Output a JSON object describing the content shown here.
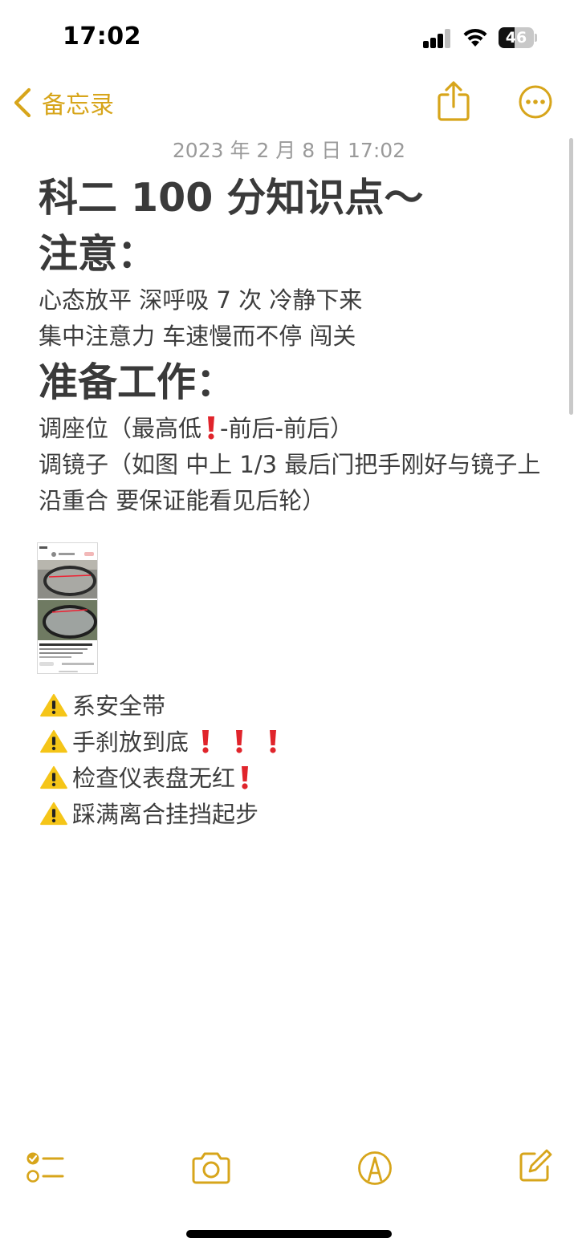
{
  "status_bar": {
    "time": "17:02",
    "battery": "46",
    "battery_level": 0.46
  },
  "nav": {
    "back_label": "备忘录"
  },
  "note": {
    "date": "2023 年 2 月 8 日 17:02",
    "title": "科二 100 分知识点～",
    "section1_heading": "注意：",
    "section1_lines": [
      "心态放平 深呼吸 7 次 冷静下来",
      "集中注意力 车速慢而不停 闯关"
    ],
    "section2_heading": "准备工作：",
    "seat_text_before": "调座位（最高低",
    "seat_text_after": "-前后-前后）",
    "mirror_text": "调镜子（如图 中上 1/3 最后门把手刚好与镜子上沿重合 要保证能看见后轮）",
    "checklist": [
      "系安全带",
      "手刹放到底",
      "检查仪表盘无红",
      "踩满离合挂挡起步"
    ]
  },
  "icons": {
    "back": "chevron-left-icon",
    "share": "share-icon",
    "more": "ellipsis-circle-icon",
    "checklist": "checklist-icon",
    "camera": "camera-icon",
    "markup": "markup-pen-icon",
    "compose": "compose-icon",
    "warning": "warning-icon",
    "exclamation": "red-exclamation-icon"
  },
  "colors": {
    "accent": "#d7a51b",
    "text": "#3d3d3d",
    "date": "#9a9a9a",
    "emoji_red": "#e0242b",
    "warning_yellow": "#f5c518"
  }
}
